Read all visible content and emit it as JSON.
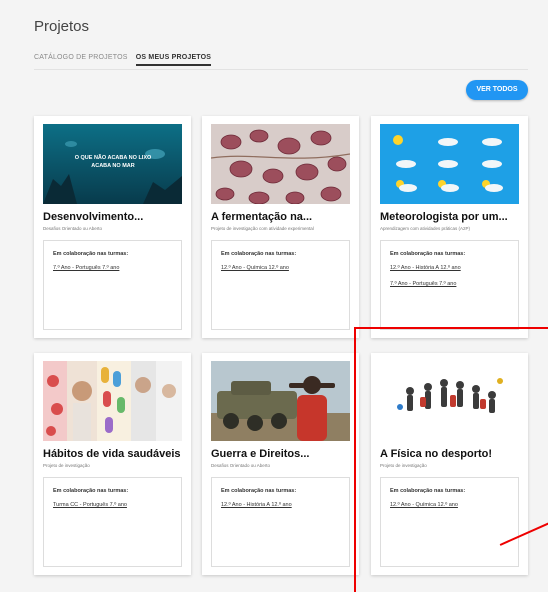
{
  "page": {
    "title": "Projetos"
  },
  "tabs": [
    {
      "label": "CATÁLOGO DE PROJETOS"
    },
    {
      "label": "OS MEUS PROJETOS"
    }
  ],
  "actions": {
    "view_all": "VER TODOS"
  },
  "collab_heading": "Em colaboração nas turmas:",
  "cards": [
    {
      "title": "Desenvolvimento...",
      "subtitle": "Desafios Orientado ou Aberto",
      "image_text": "O QUE NÃO ACABA NO LIXO ACABA NO MAR",
      "classes": [
        "7.º Ano - Português 7.º ano"
      ]
    },
    {
      "title": "A fermentação na...",
      "subtitle": "Projeto de investigação com atividade experimental",
      "classes": [
        "12.º Ano - Química 12.º ano"
      ]
    },
    {
      "title": "Meteorologista por um...",
      "subtitle": "Aprendizagem com atividades práticas (A2P)",
      "classes": [
        "12.º Ano - História A 12.º ano",
        "7.º Ano - Português 7.º ano"
      ]
    },
    {
      "title": "Hábitos de vida saudáveis",
      "subtitle": "Projeto de investigação",
      "classes": [
        "Turma CC - Português 7.º ano"
      ]
    },
    {
      "title": "Guerra e Direitos...",
      "subtitle": "Desafios Orientado ou Aberto",
      "classes": [
        "12.º Ano - História A 12.º ano"
      ]
    },
    {
      "title": "A Física no desporto!",
      "subtitle": "Projeto de investigação",
      "classes": [
        "12.º Ano - Química 12.º ano"
      ]
    }
  ],
  "colors": {
    "accent": "#2196f3",
    "annotation": "#e00000"
  }
}
